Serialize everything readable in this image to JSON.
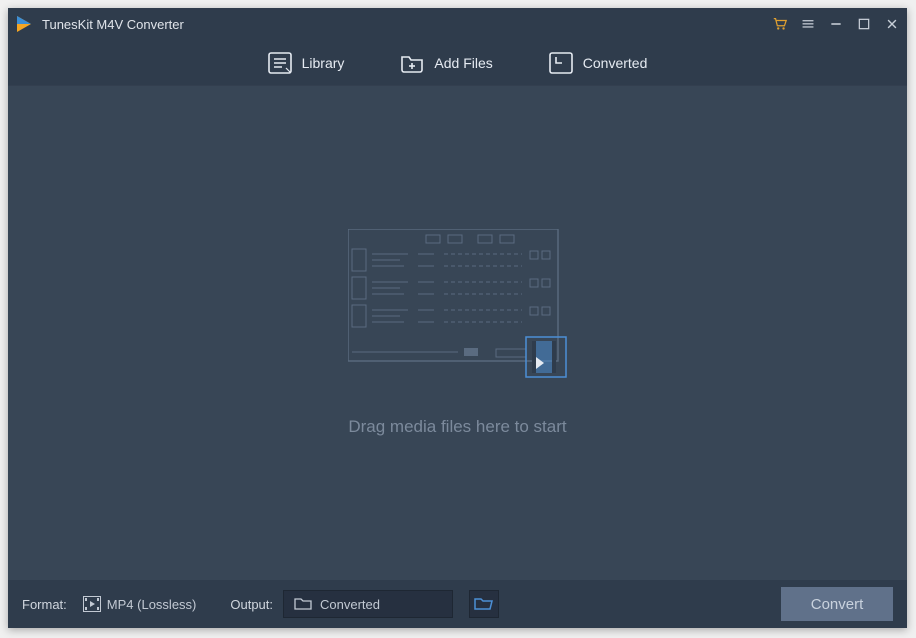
{
  "titlebar": {
    "app_title": "TunesKit M4V Converter",
    "icons": {
      "logo": "play-arrow-logo",
      "cart": "cart-icon",
      "menu": "menu-icon",
      "minimize": "minimize-icon",
      "maximize": "maximize-icon",
      "close": "close-icon"
    }
  },
  "toolbar": {
    "library": {
      "label": "Library",
      "icon": "library-list-icon"
    },
    "add_files": {
      "label": "Add Files",
      "icon": "folder-plus-icon"
    },
    "converted": {
      "label": "Converted",
      "icon": "clock-check-icon"
    }
  },
  "main": {
    "drop_hint": "Drag media files here to start"
  },
  "bottombar": {
    "format_label": "Format:",
    "format_value": "MP4 (Lossless)",
    "output_label": "Output:",
    "output_value": "Converted",
    "browse_icon": "folder-open-icon",
    "convert_label": "Convert"
  }
}
